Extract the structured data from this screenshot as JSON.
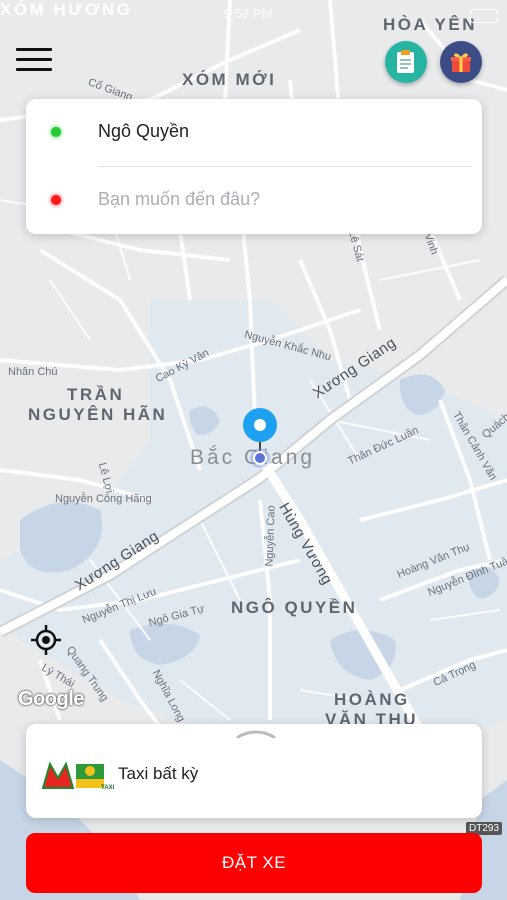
{
  "status_bar": {
    "time": "9:52 PM"
  },
  "map": {
    "areas": [
      "XÓM HƯƠNG",
      "HÒA YÊN",
      "XÓM MỚI",
      "TRẦN",
      "NGUYÊN HÃN",
      "NGÔ QUYỀN",
      "HOÀNG",
      "VĂN THỤ"
    ],
    "city": "Bắc Giang",
    "roads": [
      "Xương Giang",
      "Xương Giang",
      "Hùng Vương"
    ],
    "streets": [
      "Cổ Giang",
      "Nguyễn Khắc Nhu",
      "Cao Kỳ Vân",
      "Nguyễn Thị Lưu",
      "Ngô Gia Tự",
      "Quang Trung",
      "Lý Thái",
      "Nguyễn Cao",
      "Thân Đức Luân",
      "Thân Cảnh Văn",
      "Hoàng Văn Thụ",
      "Nguyễn Đình Tuân",
      "Cả Trọng",
      "Nguyễn Công Hãng",
      "Nghĩa Long",
      "Lê Sát",
      "Lê Lợi",
      "Nhân Chú",
      "Vinh",
      "Quách"
    ],
    "google_logo": "Google",
    "road_badge": "DT293"
  },
  "search": {
    "origin": "Ngô Quyền",
    "destination_placeholder": "Bạn muốn đến đâu?",
    "origin_color": "#22cc33",
    "destination_color": "#ff1a1a"
  },
  "vehicle": {
    "label": "Taxi bất kỳ",
    "logo_text": "TAXI"
  },
  "cta": {
    "label": "ĐẶT XE",
    "color": "#ff0000"
  },
  "icons": {
    "menu": "hamburger-icon",
    "history": "clipboard-icon",
    "promo": "gift-icon",
    "locate": "crosshair-icon",
    "pin": "location-pin-icon",
    "handle": "chevron-up-icon"
  }
}
